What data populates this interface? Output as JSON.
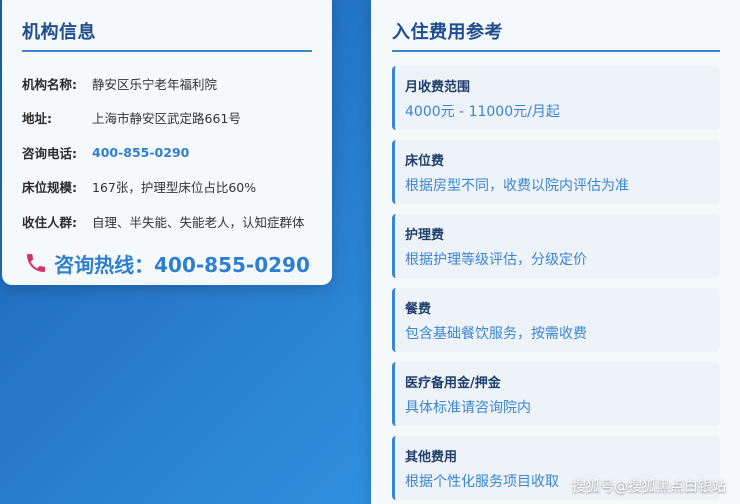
{
  "institution": {
    "title": "机构信息",
    "rows": [
      {
        "label": "机构名称:",
        "value": "静安区乐宁老年福利院"
      },
      {
        "label": "地址:",
        "value": "上海市静安区武定路661号"
      },
      {
        "label": "咨询电话:",
        "value": "400-855-0290"
      },
      {
        "label": "床位规模:",
        "value": "167张，护理型床位占比60%"
      },
      {
        "label": "收住人群:",
        "value": "自理、半失能、失能老人，认知症群体"
      }
    ],
    "hotline": "咨询热线：400-855-0290",
    "hotline_icon": "phone-icon"
  },
  "fees": {
    "title": "入住费用参考",
    "items": [
      {
        "name": "月收费范围",
        "desc": "4000元 - 11000元/月起"
      },
      {
        "name": "床位费",
        "desc": "根据房型不同，收费以院内评估为准"
      },
      {
        "name": "护理费",
        "desc": "根据护理等级评估，分级定价"
      },
      {
        "name": "餐费",
        "desc": "包含基础餐饮服务，按需收费"
      },
      {
        "name": "医疗备用金/押金",
        "desc": "具体标准请咨询院内"
      },
      {
        "name": "其他费用",
        "desc": "根据个性化服务项目收取"
      }
    ]
  },
  "watermark": "搜狐号@搜狐黑点白银站",
  "colors": {
    "accent": "#3b86d0",
    "title": "#1f4e8c",
    "hotline_icon": "#d6336c"
  }
}
